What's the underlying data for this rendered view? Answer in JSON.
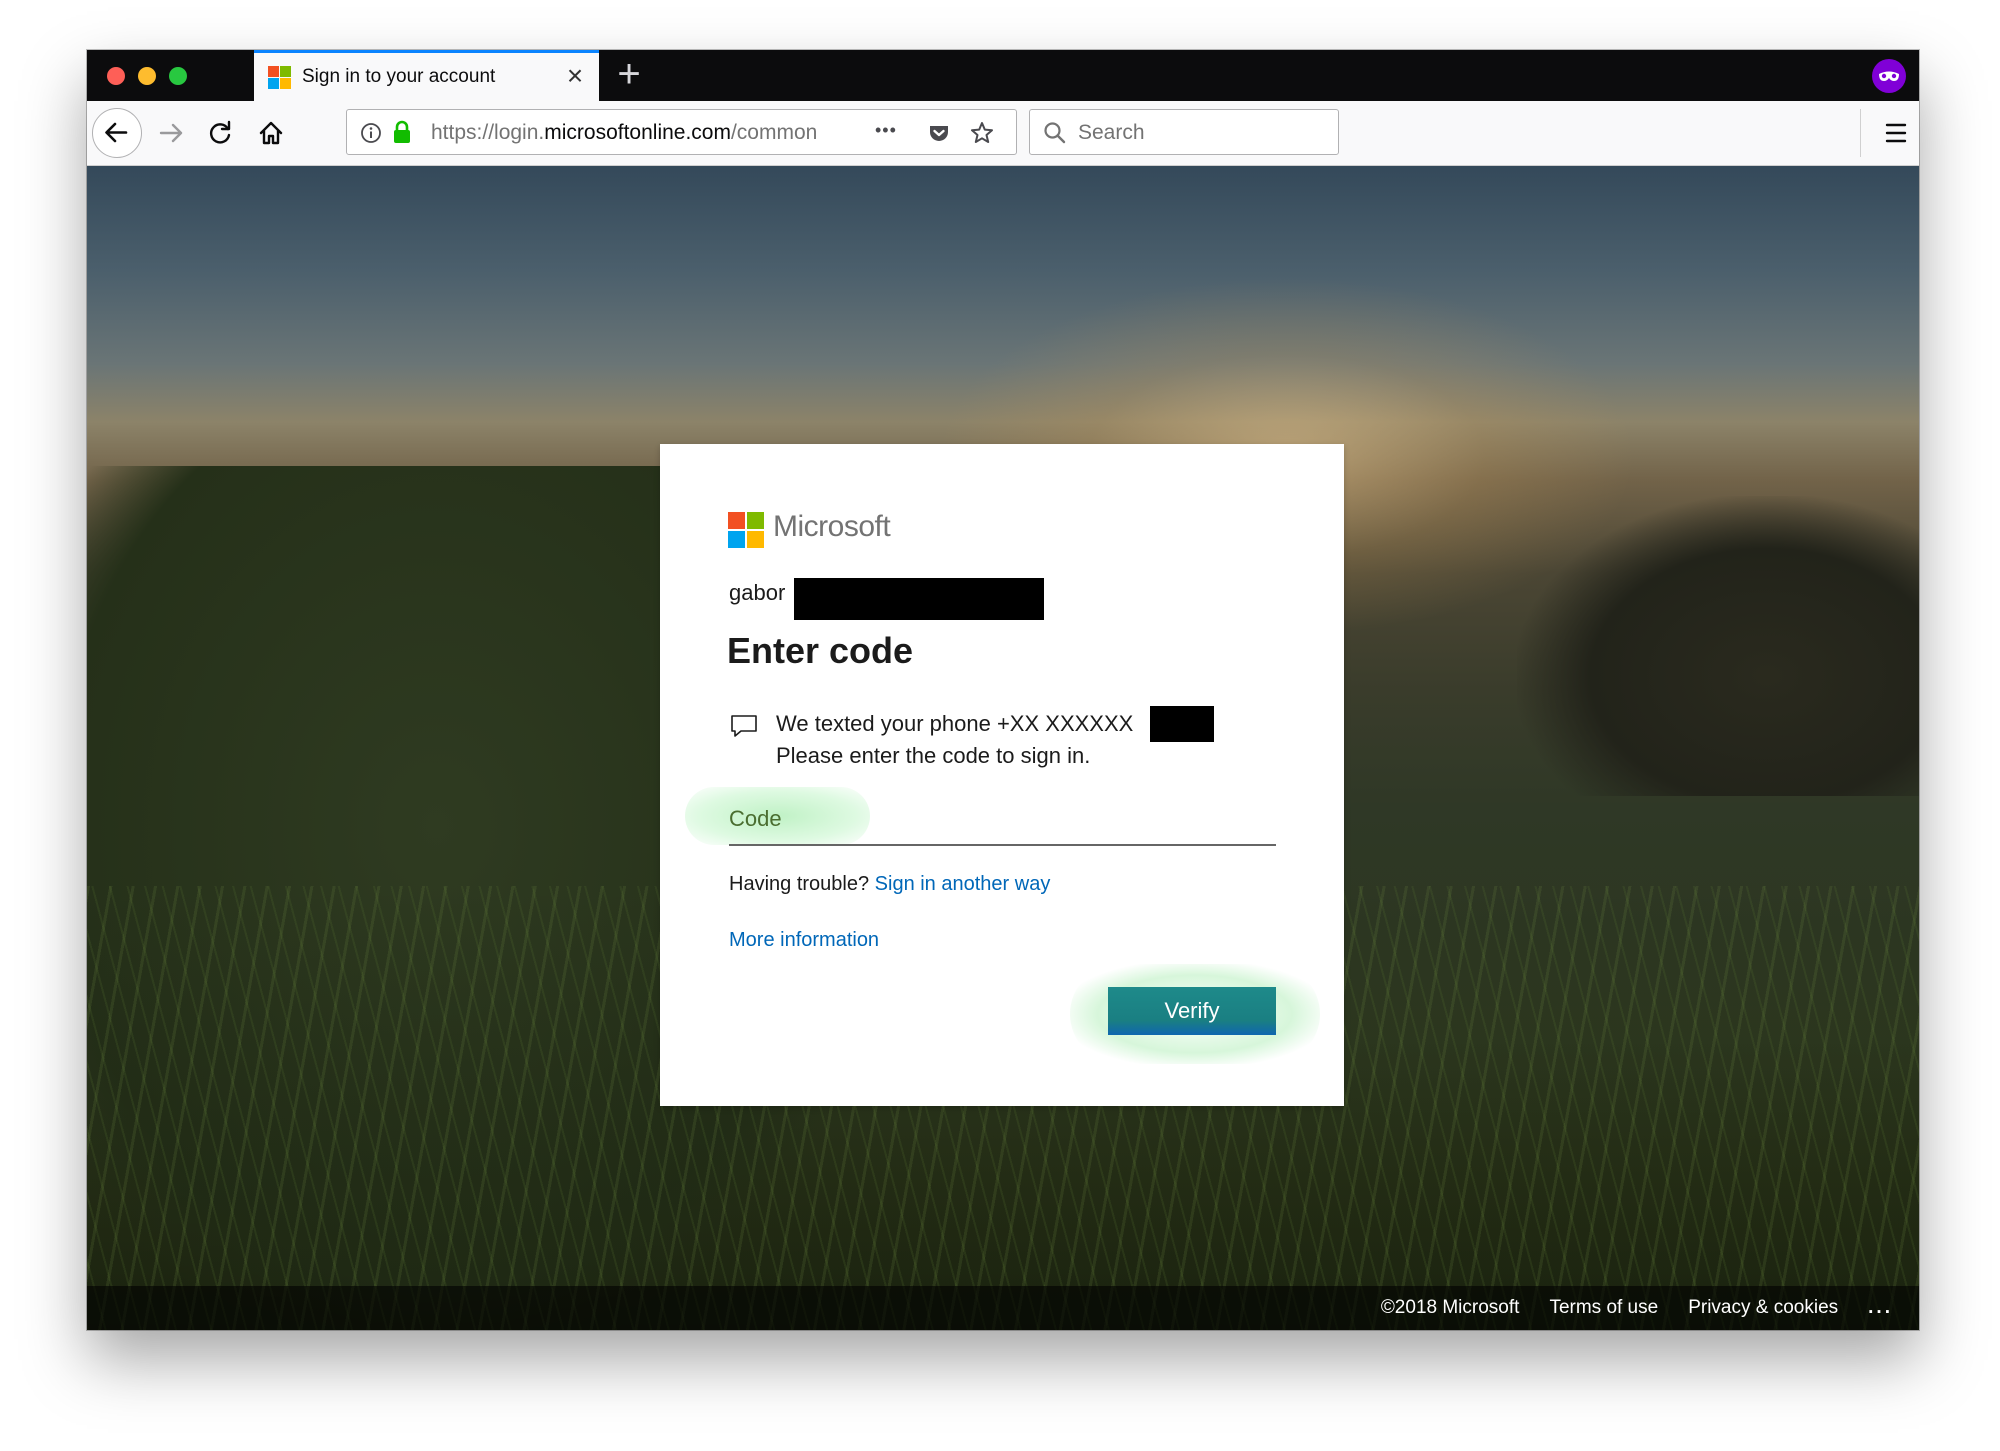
{
  "browser": {
    "tab_title": "Sign in to your account",
    "tab_close": "×",
    "new_tab": "+",
    "url_prefix": "https://login.",
    "url_domain": "microsoftonline.com",
    "url_suffix": "/common",
    "page_actions": "•••",
    "search_placeholder": "Search",
    "icons": [
      "back-arrow-icon",
      "forward-arrow-icon",
      "reload-icon",
      "home-icon",
      "info-icon",
      "lock-icon",
      "pocket-icon",
      "bookmark-star-icon",
      "search-icon",
      "hamburger-menu-icon",
      "private-browsing-mask-icon"
    ],
    "colors": {
      "tab_accent": "#0a84ff",
      "private_mask": "#8000d7",
      "lock": "#12bc00"
    }
  },
  "signin": {
    "brand": "Microsoft",
    "account_prefix": "gabor",
    "heading": "Enter code",
    "sms_line1": "We texted your phone +XX XXXXXX",
    "sms_line2": "Please enter the code to sign in.",
    "code_placeholder": "Code",
    "trouble_text": "Having trouble?",
    "trouble_link": "Sign in another way",
    "more_info_link": "More information",
    "verify_button": "Verify",
    "colors": {
      "link": "#0067b8",
      "logo": [
        "#f25022",
        "#7fba00",
        "#00a4ef",
        "#ffb900"
      ]
    }
  },
  "footer": {
    "copyright": "©2018 Microsoft",
    "terms": "Terms of use",
    "privacy": "Privacy & cookies",
    "more": "..."
  }
}
